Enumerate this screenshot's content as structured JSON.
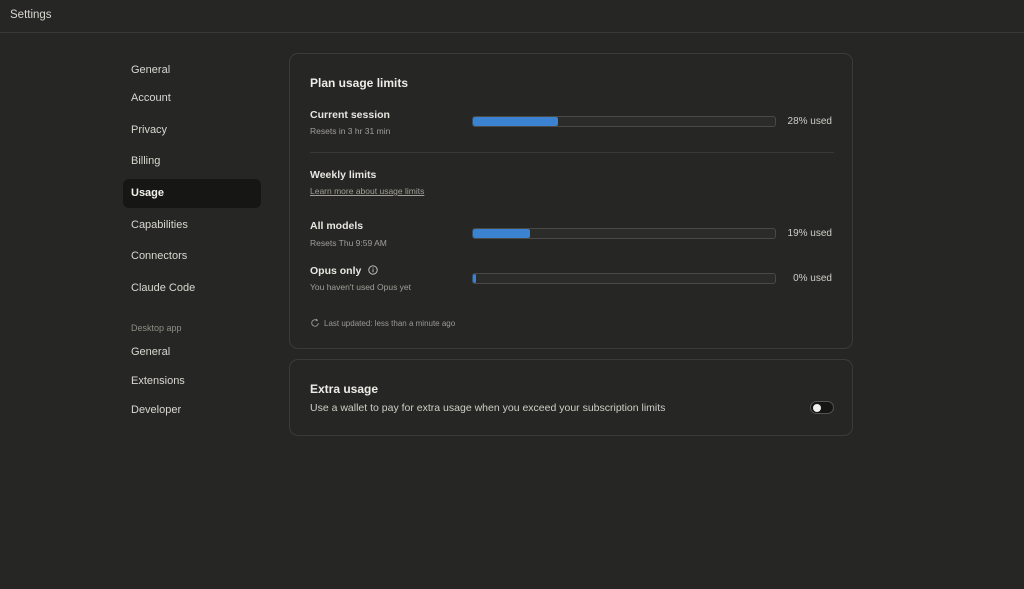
{
  "window": {
    "title": "Settings"
  },
  "sidebar": {
    "items": [
      {
        "label": "General"
      },
      {
        "label": "Account"
      },
      {
        "label": "Privacy"
      },
      {
        "label": "Billing"
      },
      {
        "label": "Usage",
        "active": true
      },
      {
        "label": "Capabilities"
      },
      {
        "label": "Connectors"
      },
      {
        "label": "Claude Code"
      }
    ],
    "desktop_section": "Desktop app",
    "desktop_items": [
      {
        "label": "General"
      },
      {
        "label": "Extensions"
      },
      {
        "label": "Developer"
      }
    ]
  },
  "usage": {
    "title": "Plan usage limits",
    "current_session": {
      "label": "Current session",
      "sub": "Resets in 3 hr 31 min",
      "percent": 28,
      "percent_text": "28% used"
    },
    "weekly": {
      "label": "Weekly limits",
      "link": "Learn more about usage limits"
    },
    "all_models": {
      "label": "All models",
      "sub": "Resets Thu 9:59 AM",
      "percent": 19,
      "percent_text": "19% used"
    },
    "opus": {
      "label": "Opus only",
      "sub": "You haven't used Opus yet",
      "percent": 0,
      "percent_text": "0% used"
    },
    "last_updated": "Last updated: less than a minute ago"
  },
  "extra": {
    "title": "Extra usage",
    "description": "Use a wallet to pay for extra usage when you exceed your subscription limits",
    "enabled": false
  },
  "colors": {
    "background": "#262624",
    "accent": "#3b82d1",
    "active_nav": "#161615"
  }
}
